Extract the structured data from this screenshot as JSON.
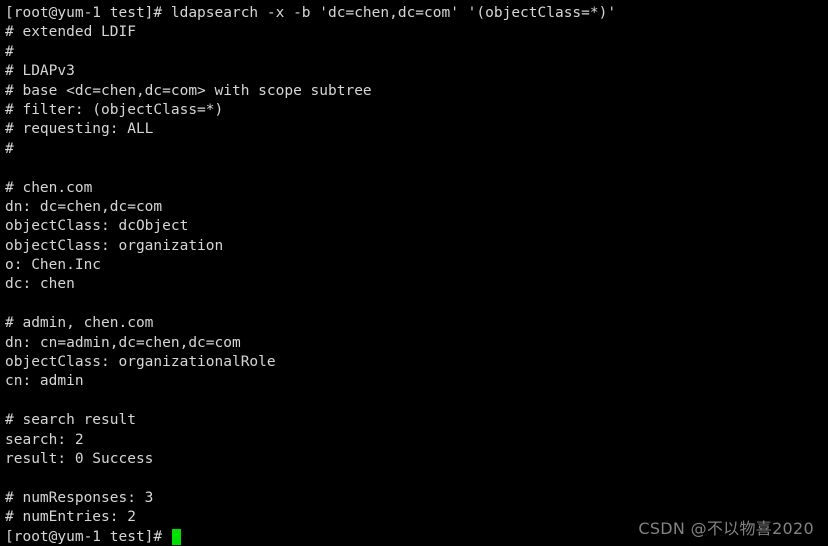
{
  "terminal": {
    "background_color": "#000000",
    "foreground_color": "#d6d6d6",
    "cursor_color": "#00e000",
    "prompt": "[root@yum-1 test]#",
    "command": "ldapsearch -x -b 'dc=chen,dc=com' '(objectClass=*)'",
    "lines": [
      "[root@yum-1 test]# ldapsearch -x -b 'dc=chen,dc=com' '(objectClass=*)'",
      "# extended LDIF",
      "#",
      "# LDAPv3",
      "# base <dc=chen,dc=com> with scope subtree",
      "# filter: (objectClass=*)",
      "# requesting: ALL",
      "#",
      "",
      "# chen.com",
      "dn: dc=chen,dc=com",
      "objectClass: dcObject",
      "objectClass: organization",
      "o: Chen.Inc",
      "dc: chen",
      "",
      "# admin, chen.com",
      "dn: cn=admin,dc=chen,dc=com",
      "objectClass: organizationalRole",
      "cn: admin",
      "",
      "# search result",
      "search: 2",
      "result: 0 Success",
      "",
      "# numResponses: 3",
      "# numEntries: 2"
    ],
    "final_prompt": "[root@yum-1 test]# "
  },
  "watermark": {
    "text": "CSDN @不以物喜2020",
    "color": "#9a9a9a"
  }
}
